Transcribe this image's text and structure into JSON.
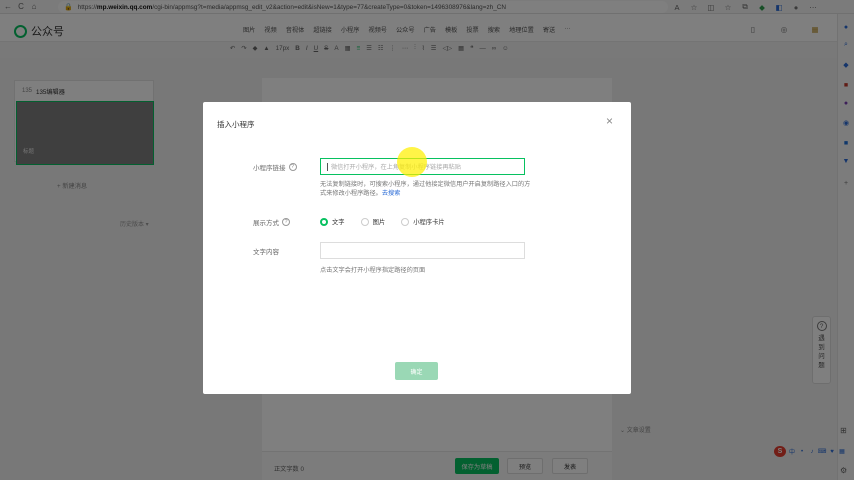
{
  "browser": {
    "url_prefix": "https://",
    "url_host": "mp.weixin.qq.com",
    "url_rest": "/cgi-bin/appmsg?t=media/appmsg_edit_v2&action=edit&isNew=1&type=77&createType=0&token=1496308976&lang=zh_CN"
  },
  "app": {
    "logo_text": "公众号",
    "nav": [
      "图片",
      "视频",
      "音视体",
      "超链接",
      "小程序",
      "视频号",
      "公众号",
      "广告",
      "模板",
      "投票",
      "搜索",
      "地理位置",
      "寄送",
      "···"
    ]
  },
  "editor_toolbar": [
    "↶",
    "↷",
    "◆",
    "▲",
    "17px",
    "B",
    "I",
    "U",
    "S",
    "A",
    "▦",
    "≡",
    "☰",
    "☷",
    "⋮",
    "⋯",
    "⫶",
    "⌇",
    "☰",
    "◁▷",
    "▦",
    "❝",
    "—",
    "∞",
    "☺"
  ],
  "left_panel": {
    "tag": "135",
    "editor_name": "135编辑器",
    "thumb_caption": "标题",
    "new_message": "+ 新建消息",
    "history": "历史版本 ▾"
  },
  "canvas": {
    "more_settings": "⌄ 文章设置",
    "word_count": "正文字数 0",
    "save_label": "保存为草稿",
    "preview_label": "预览",
    "publish_label": "发表"
  },
  "help": {
    "text": "遇到问题"
  },
  "dialog": {
    "title": "插入小程序",
    "close": "×",
    "link_label": "小程序链接",
    "link_placeholder": "微信打开小程序，在上角复制小程序链接再粘贴",
    "hint_text": "无法复制链接时，可搜索小程序，通过他接定微信用户开启复制路径入口的方式来修改小程序路径。",
    "hint_link": "去搜索",
    "display_label": "展示方式",
    "display_options": [
      {
        "label": "文字",
        "selected": true
      },
      {
        "label": "图片",
        "selected": false
      },
      {
        "label": "小程序卡片",
        "selected": false
      }
    ],
    "text_label": "文字内容",
    "text_note": "点击文字会打开小程序指定路径的页面",
    "confirm_label": "确定"
  },
  "colors": {
    "accent": "#07c160",
    "confirm_disabled": "#9ad8b5",
    "link": "#2a6bd6"
  }
}
